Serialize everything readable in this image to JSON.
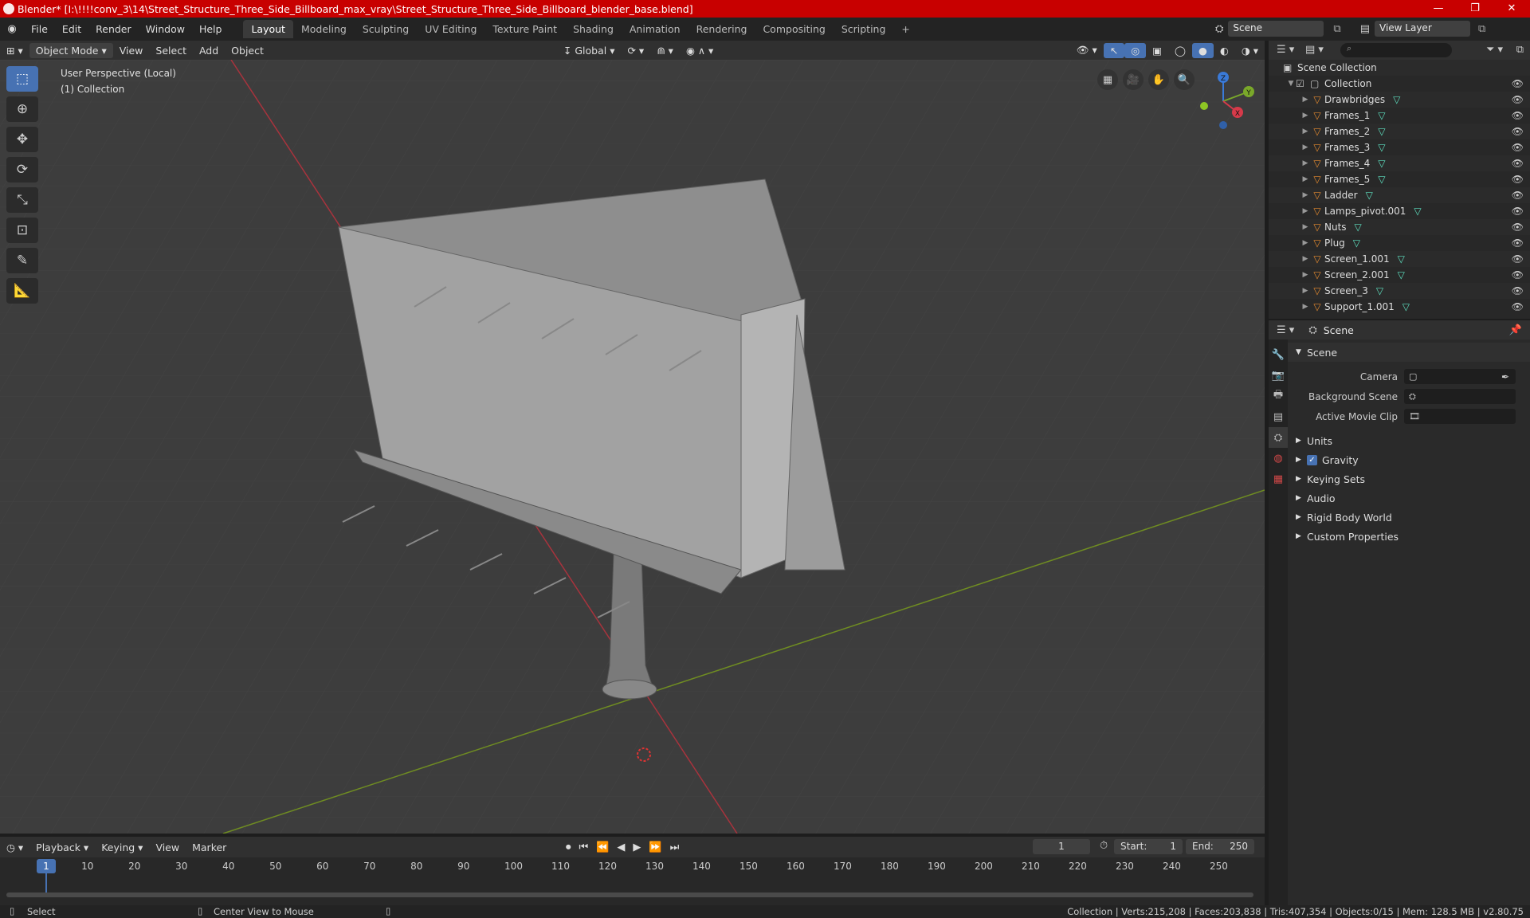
{
  "window": {
    "title": "Blender* [I:\\!!!!conv_3\\14\\Street_Structure_Three_Side_Billboard_max_vray\\Street_Structure_Three_Side_Billboard_blender_base.blend]",
    "minimize": "—",
    "maximize": "❐",
    "close": "✕"
  },
  "menu": [
    "File",
    "Edit",
    "Render",
    "Window",
    "Help"
  ],
  "workspaces": [
    "Layout",
    "Modeling",
    "Sculpting",
    "UV Editing",
    "Texture Paint",
    "Shading",
    "Animation",
    "Rendering",
    "Compositing",
    "Scripting"
  ],
  "workspace_add": "+",
  "scene_selector": {
    "value": "Scene"
  },
  "viewlayer_selector": {
    "value": "View Layer"
  },
  "viewport_header": {
    "mode": "Object Mode",
    "menus": [
      "View",
      "Select",
      "Add",
      "Object"
    ],
    "transform_orientation": "Global"
  },
  "viewport": {
    "perspective_label": "User Perspective (Local)",
    "collection_label": "(1) Collection",
    "gizmo": {
      "z": "Z",
      "y": "Y",
      "x": "X"
    }
  },
  "outliner": {
    "root": "Scene Collection",
    "collection": "Collection",
    "objects": [
      "Drawbridges",
      "Frames_1",
      "Frames_2",
      "Frames_3",
      "Frames_4",
      "Frames_5",
      "Ladder",
      "Lamps_pivot.001",
      "Nuts",
      "Plug",
      "Screen_1.001",
      "Screen_2.001",
      "Screen_3",
      "Support_1.001"
    ]
  },
  "properties": {
    "header_title": "Scene",
    "section_title": "Scene",
    "fields": [
      {
        "label": "Camera",
        "value": ""
      },
      {
        "label": "Background Scene",
        "value": ""
      },
      {
        "label": "Active Movie Clip",
        "value": ""
      }
    ],
    "panels": [
      "Units",
      "Gravity",
      "Keying Sets",
      "Audio",
      "Rigid Body World",
      "Custom Properties"
    ],
    "gravity_checked": true
  },
  "timeline": {
    "menus": [
      "Playback",
      "Keying",
      "View",
      "Marker"
    ],
    "current_frame": "1",
    "start_label": "Start:",
    "start": "1",
    "end_label": "End:",
    "end": "250",
    "ticks": [
      "10",
      "20",
      "30",
      "40",
      "50",
      "60",
      "70",
      "80",
      "90",
      "100",
      "110",
      "120",
      "130",
      "140",
      "150",
      "160",
      "170",
      "180",
      "190",
      "200",
      "210",
      "220",
      "230",
      "240",
      "250"
    ],
    "cursor_frame": "1"
  },
  "status": {
    "left_action": "Select",
    "mid_action": "Center View to Mouse",
    "stats": "Collection | Verts:215,208 | Faces:203,838 | Tris:407,354 | Objects:0/15 | Mem: 128.5 MB | v2.80.75"
  }
}
